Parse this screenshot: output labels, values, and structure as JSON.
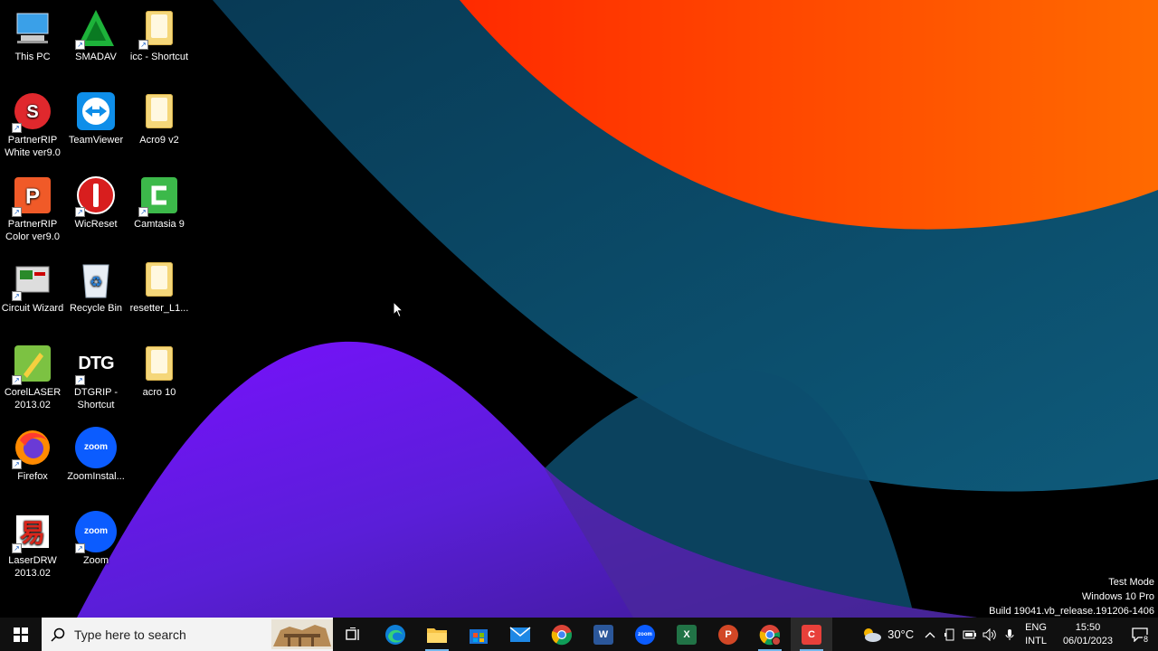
{
  "desktop": {
    "icons": [
      {
        "label": "This PC",
        "icon": "this-pc-icon"
      },
      {
        "label": "SMADAV",
        "icon": "smadav-icon"
      },
      {
        "label": "icc - Shortcut",
        "icon": "folder-shortcut-icon"
      },
      {
        "label": "PartnerRIP White ver9.0",
        "icon": "partnerrip-white-icon"
      },
      {
        "label": "TeamViewer",
        "icon": "teamviewer-icon"
      },
      {
        "label": "Acro9 v2",
        "icon": "folder-icon"
      },
      {
        "label": "PartnerRIP Color ver9.0",
        "icon": "partnerrip-color-icon"
      },
      {
        "label": "WicReset",
        "icon": "wicreset-icon"
      },
      {
        "label": "Camtasia 9",
        "icon": "camtasia-icon"
      },
      {
        "label": "Circuit Wizard",
        "icon": "circuit-wizard-icon"
      },
      {
        "label": "Recycle Bin",
        "icon": "recycle-bin-icon"
      },
      {
        "label": "resetter_L1...",
        "icon": "folder-icon"
      },
      {
        "label": "CorelLASER 2013.02",
        "icon": "corellaser-icon"
      },
      {
        "label": "DTGRIP - Shortcut",
        "icon": "dtgrip-icon"
      },
      {
        "label": "acro 10",
        "icon": "folder-icon"
      },
      {
        "label": "Firefox",
        "icon": "firefox-icon"
      },
      {
        "label": "ZoomInstal...",
        "icon": "zoom-installer-icon"
      },
      {
        "label": "LaserDRW 2013.02",
        "icon": "laserdrw-icon"
      },
      {
        "label": "Zoom",
        "icon": "zoom-icon"
      }
    ],
    "dtg_text": "DTG",
    "zoom_text": "zoom",
    "watermark": {
      "line1": "Test Mode",
      "line2": "Windows 10 Pro",
      "line3": "Build 19041.vb_release.191206-1406"
    }
  },
  "taskbar": {
    "search_placeholder": "Type here to search",
    "apps": [
      {
        "name": "task-view",
        "icon": "task-view-icon"
      },
      {
        "name": "edge",
        "icon": "edge-icon"
      },
      {
        "name": "file-explorer",
        "icon": "folder-icon"
      },
      {
        "name": "microsoft-store",
        "icon": "store-icon"
      },
      {
        "name": "mail",
        "icon": "mail-icon"
      },
      {
        "name": "chrome",
        "icon": "chrome-icon"
      },
      {
        "name": "word",
        "icon": "word-icon"
      },
      {
        "name": "zoom",
        "icon": "zoom-icon"
      },
      {
        "name": "excel",
        "icon": "excel-icon"
      },
      {
        "name": "powerpoint",
        "icon": "powerpoint-icon"
      },
      {
        "name": "chrome-profile",
        "icon": "chrome-icon"
      },
      {
        "name": "camtasia",
        "icon": "camtasia-icon"
      }
    ],
    "weather": {
      "temperature": "30°C",
      "icon": "cloudy-icon"
    },
    "language": {
      "line1": "ENG",
      "line2": "INTL"
    },
    "clock": {
      "time": "15:50",
      "date": "06/01/2023"
    },
    "notification_count": "8"
  },
  "colors": {
    "orange": "#ff5a00",
    "teal": "#0b4a66",
    "purple": "#8a1cff",
    "taskbar": "#101010"
  }
}
